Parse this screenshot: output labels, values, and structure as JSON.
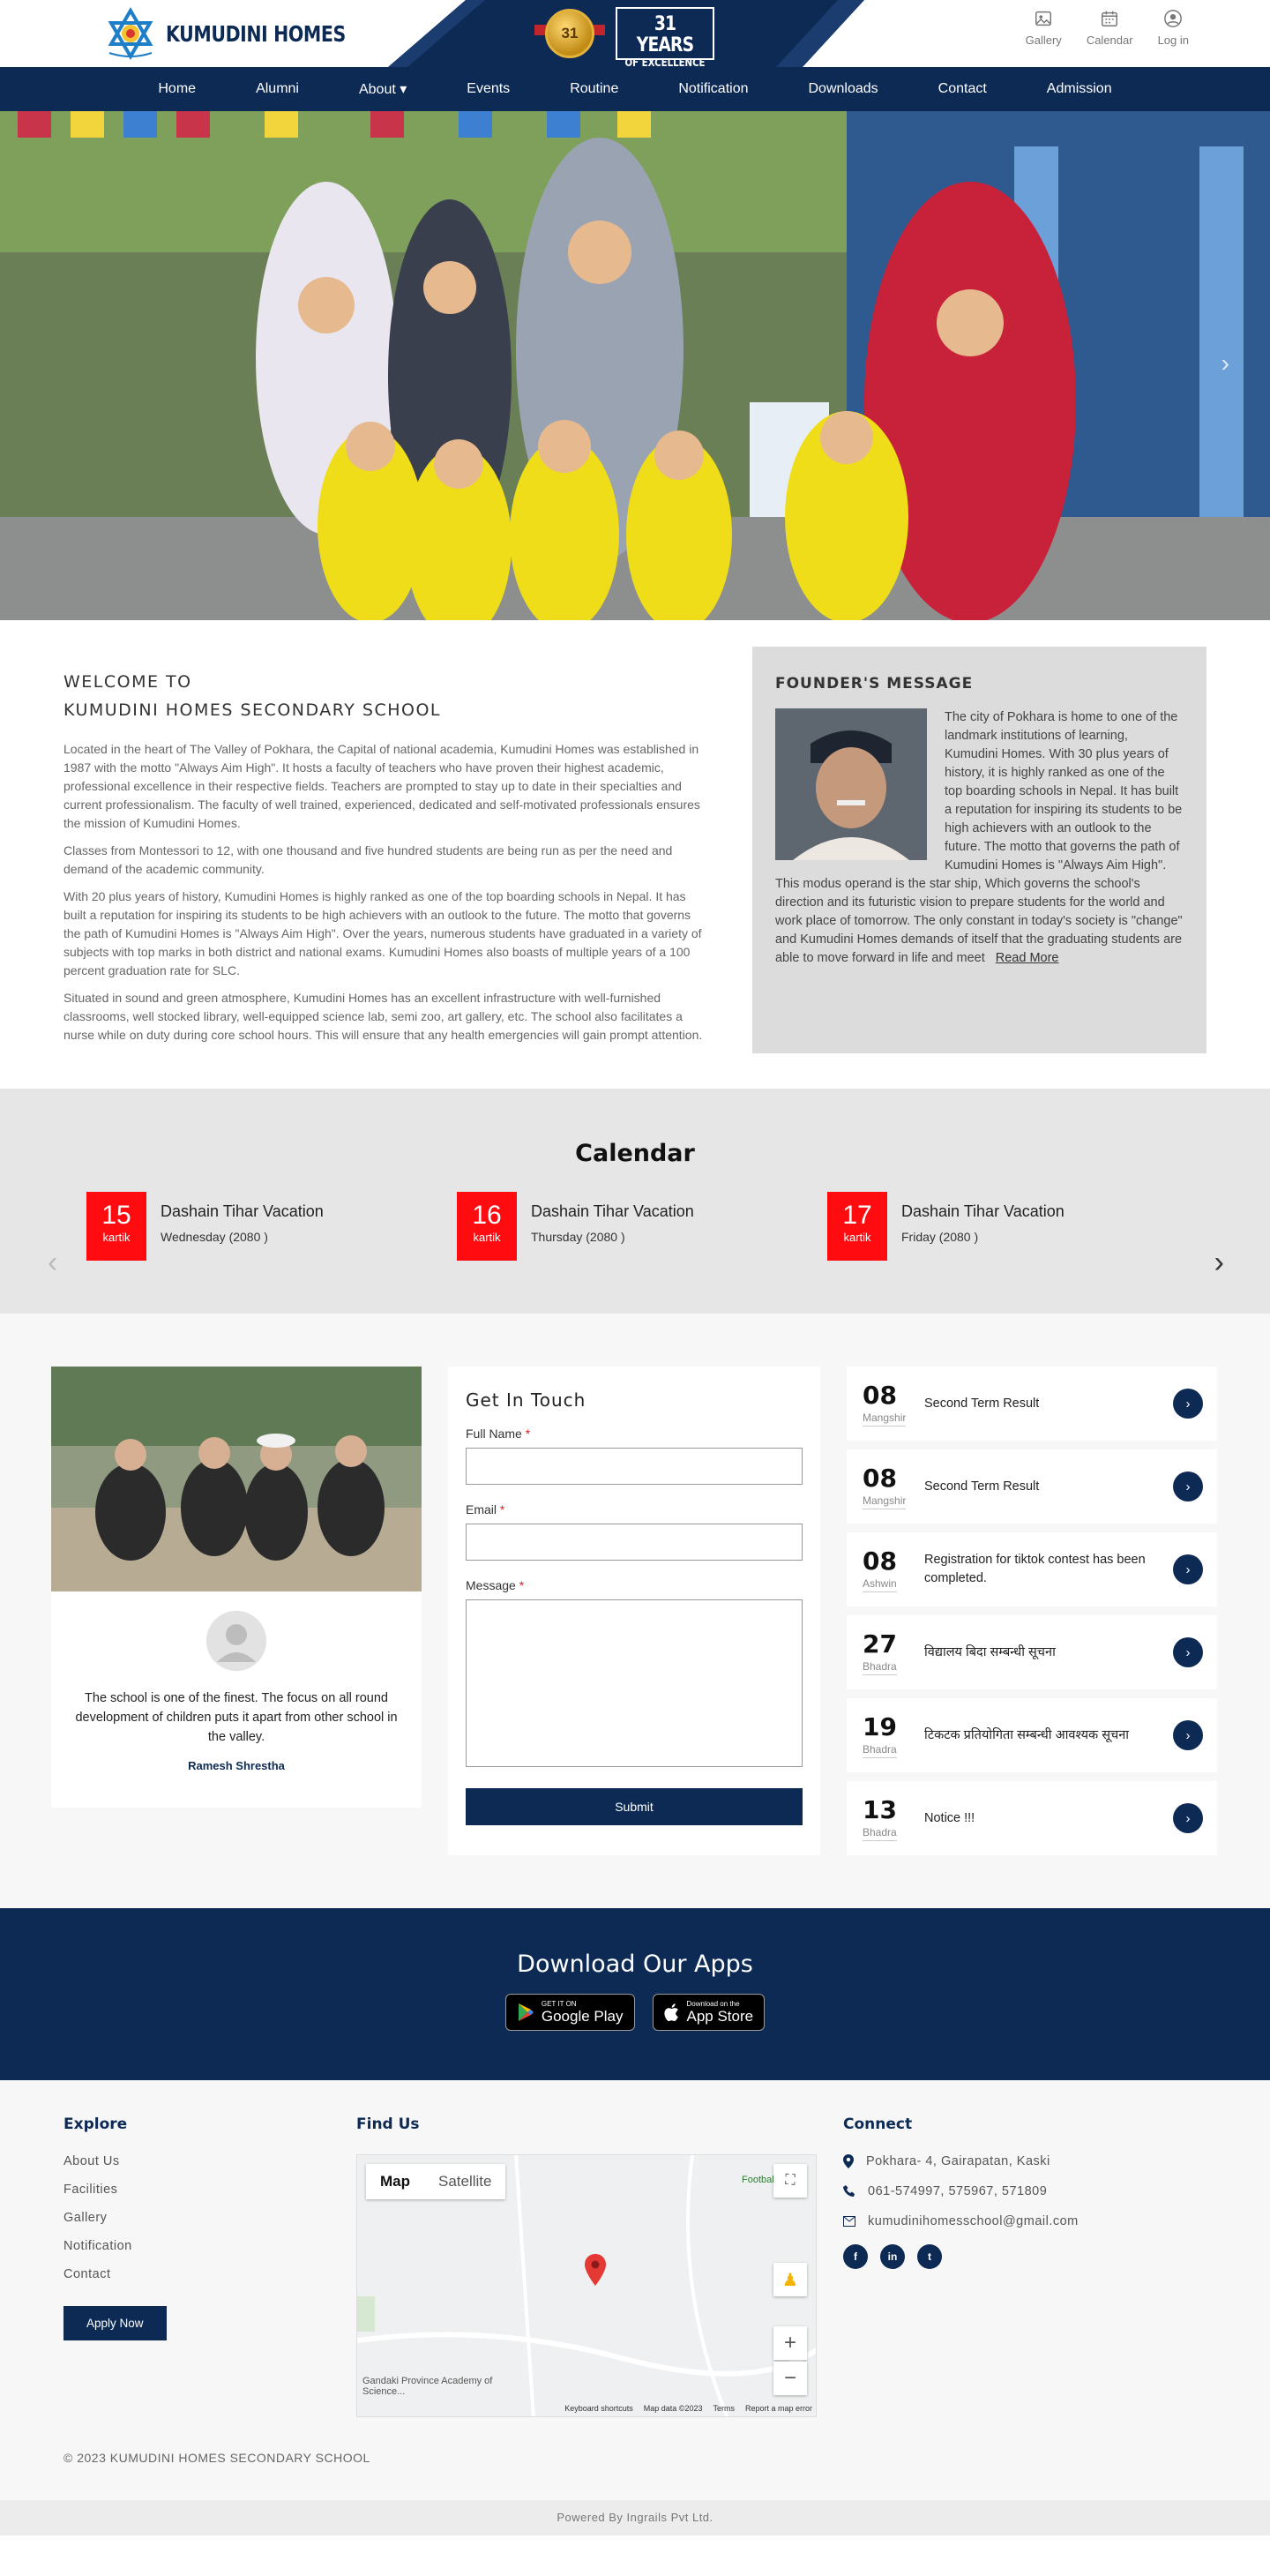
{
  "header": {
    "school_name": "KUMUDINI HOMES",
    "medal_number": "31",
    "years_big": "31 YEARS",
    "years_small": "OF EXCELLENCE",
    "icons": [
      {
        "label": "Gallery",
        "icon": "gallery-icon"
      },
      {
        "label": "Calendar",
        "icon": "calendar-icon"
      },
      {
        "label": "Log in",
        "icon": "user-icon"
      }
    ]
  },
  "nav": {
    "items": [
      "Home",
      "Alumni",
      "About ▾",
      "Events",
      "Routine",
      "Notification",
      "Downloads",
      "Contact",
      "Admission"
    ]
  },
  "welcome": {
    "line1": "WELCOME TO",
    "line2": "KUMUDINI HOMES SECONDARY SCHOOL",
    "paragraphs": [
      "Located in the heart of The Valley of Pokhara, the Capital of national academia, Kumudini Homes was established in 1987 with the motto \"Always Aim High\". It hosts a faculty of teachers who have proven their highest academic, professional excellence in their respective fields. Teachers are prompted to stay up to date in their specialties and current professionalism. The faculty of well trained, experienced, dedicated and self-motivated professionals ensures the mission of Kumudini Homes.",
      "Classes from Montessori to 12, with one thousand and five hundred students are being run as per the need and demand of the academic community.",
      "With 20 plus years of history, Kumudini Homes is highly ranked as one of the top boarding schools in Nepal. It has built a reputation for inspiring its students to be high achievers with an outlook to the future. The motto that governs the path of Kumudini Homes is \"Always Aim High\". Over the years, numerous students have graduated in a variety of subjects with top marks in both district and national exams. Kumudini Homes also boasts of multiple years of a 100 percent graduation rate for SLC.",
      "Situated in sound and green atmosphere, Kumudini Homes has an excellent infrastructure with well-furnished classrooms, well stocked library, well-equipped science lab, semi zoo, art gallery, etc. The school also facilitates a nurse while on duty during core school hours. This will ensure that any health emergencies will gain prompt attention."
    ]
  },
  "founder": {
    "title": "FOUNDER'S MESSAGE",
    "body": "The city of Pokhara is home to one of the landmark institutions of learning, Kumudini Homes. With 30 plus years of history, it is highly ranked as one of the top boarding schools in Nepal. It has built a reputation for inspiring its students to be high achievers with an outlook to the future. The motto that governs the path of Kumudini Homes is \"Always Aim High\". This modus operand is the star ship, Which governs the school's direction and its futuristic vision to prepare students for the world and work place of tomorrow. The only constant in today's society is \"change\" and Kumudini Homes demands of itself that the graduating students are able to move forward in life and meet",
    "read_more": "Read More"
  },
  "calendar": {
    "title": "Calendar",
    "events": [
      {
        "day": "15",
        "month": "kartik",
        "title": "Dashain Tihar Vacation",
        "sub": "Wednesday (2080 )"
      },
      {
        "day": "16",
        "month": "kartik",
        "title": "Dashain Tihar Vacation",
        "sub": "Thursday (2080 )"
      },
      {
        "day": "17",
        "month": "kartik",
        "title": "Dashain Tihar Vacation",
        "sub": "Friday (2080 )"
      }
    ]
  },
  "testimonial": {
    "text": "The school is one of the finest. The focus on all round development of children puts it apart from other school in the valley.",
    "name": "Ramesh Shrestha"
  },
  "contact_form": {
    "title": "Get In Touch",
    "full_name_label": "Full Name",
    "email_label": "Email",
    "message_label": "Message",
    "required_mark": "*",
    "full_name_value": "",
    "email_value": "",
    "message_value": "",
    "submit": "Submit"
  },
  "notices": [
    {
      "day": "08",
      "month": "Mangshir",
      "title": "Second Term Result"
    },
    {
      "day": "08",
      "month": "Mangshir",
      "title": "Second Term Result"
    },
    {
      "day": "08",
      "month": "Ashwin",
      "title": "Registration for tiktok contest has been completed."
    },
    {
      "day": "27",
      "month": "Bhadra",
      "title": "विद्यालय बिदा सम्बन्धी सूचना"
    },
    {
      "day": "19",
      "month": "Bhadra",
      "title": "टिकटक प्रतियोगिता सम्बन्धी आवश्यक सूचना"
    },
    {
      "day": "13",
      "month": "Bhadra",
      "title": "Notice !!!"
    }
  ],
  "apps": {
    "title": "Download Our Apps",
    "google_small": "GET IT ON",
    "google_big": "Google Play",
    "apple_small": "Download on the",
    "apple_big": "App Store"
  },
  "footer": {
    "explore_title": "Explore",
    "explore_links": [
      "About Us",
      "Facilities",
      "Gallery",
      "Notification",
      "Contact"
    ],
    "apply": "Apply Now",
    "find_title": "Find Us",
    "map_tab_map": "Map",
    "map_tab_sat": "Satellite",
    "map_label_1": "Football",
    "map_label_2": "Gandaki Province Academy of Science...",
    "map_keyboard": "Keyboard shortcuts",
    "map_data": "Map data ©2023",
    "map_terms": "Terms",
    "map_report": "Report a map error",
    "connect_title": "Connect",
    "address": "Pokhara- 4, Gairapatan, Kaski",
    "phone": "061-574997, 575967, 571809",
    "email": "kumudinihomesschool@gmail.com",
    "social": [
      "f",
      "in",
      "t"
    ],
    "copyright": "© 2023 KUMUDINI HOMES SECONDARY SCHOOL",
    "powered": "Powered By Ingrails Pvt Ltd."
  },
  "colors": {
    "primary": "#0d2a55",
    "calendar_date": "#ff0b10",
    "founder_bg": "#dcdcdc"
  }
}
